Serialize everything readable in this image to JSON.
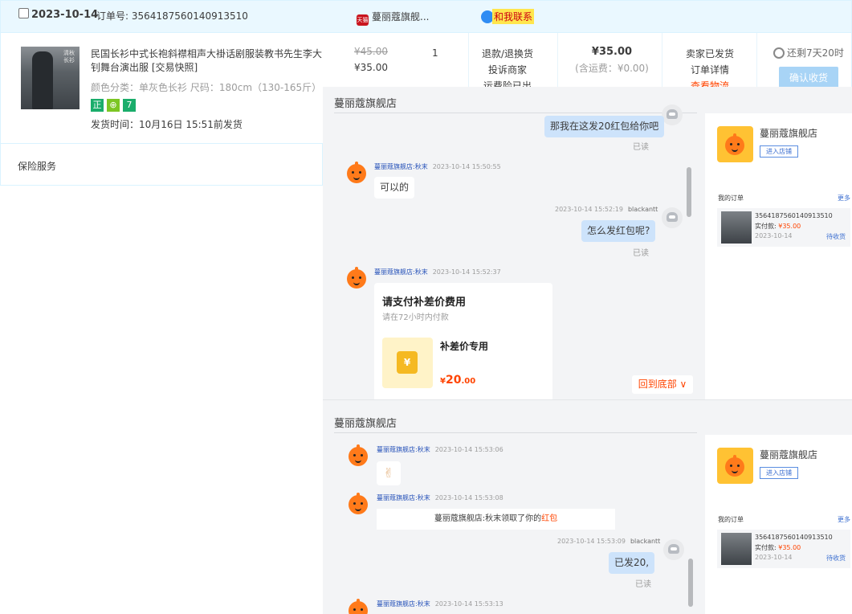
{
  "order": {
    "date": "2023-10-14",
    "order_no_label": "订单号: 3564187560140913510",
    "shop_name": "蔓丽蔻旗舰...",
    "shop_icon_text": "天猫",
    "contact_label": "和我联系",
    "product_title": "民国长衫中式长袍斜襟相声大褂话剧服装教书先生李大钊舞台演出服 [交易快照]",
    "thumb_text": "清秋长衫",
    "attrs": "颜色分类：单灰色长衫   尺码：180cm（130-165斤）",
    "badges": [
      {
        "text": "正",
        "color": "#1aad6b"
      },
      {
        "text": "⊕",
        "color": "#1aad6b"
      },
      {
        "text": "7",
        "color": "#1aad6b"
      }
    ],
    "ship_time": "发货时间：10月16日 15:51前发货",
    "price_old": "¥45.00",
    "price_new": "¥35.00",
    "quantity": "1",
    "after_sale": [
      "退款/退换货",
      "投诉商家",
      "运费险已出单"
    ],
    "total": "¥35.00",
    "shipping": "(含运费：¥0.00)",
    "status_lines": [
      "卖家已发货",
      "订单详情",
      "查看物流"
    ],
    "remaining": "还剩7天20时",
    "confirm_button": "确认收货",
    "insurance": "保险服务"
  },
  "chat1": {
    "shop_title": "蔓丽蔻旗舰店",
    "messages": {
      "m0_text": "那我在这发20红包给你吧",
      "m0_read": "已读",
      "m1_name": "蔓丽蔻旗舰店:秋末",
      "m1_time": "2023-10-14 15:50:55",
      "m1_text": "可以的",
      "m2_time": "2023-10-14 15:52:19",
      "m2_name": "blackantt",
      "m2_text": "怎么发红包呢?",
      "m2_read": "已读",
      "m3_name": "蔓丽蔻旗舰店:秋末",
      "m3_time": "2023-10-14 15:52:37"
    },
    "pay_card": {
      "title": "请支付补差价费用",
      "subtitle": "请在72小时内付款",
      "item_name": "补差价专用",
      "currency": "¥",
      "price_int": "20",
      "price_dec": ".00",
      "coin_text": "¥"
    },
    "back_bottom": "回到底部 ∨"
  },
  "chat2": {
    "shop_title": "蔓丽蔻旗舰店",
    "messages": {
      "m1_name": "蔓丽蔻旗舰店:秋末",
      "m1_time": "2023-10-14 15:53:06",
      "m1_emoji": "✌",
      "m2_name": "蔓丽蔻旗舰店:秋末",
      "m2_time": "2023-10-14 15:53:08",
      "notice_prefix": "蔓丽蔻旗舰店:秋末领取了你的",
      "notice_red": "红包",
      "m3_time": "2023-10-14 15:53:09",
      "m3_name": "blackantt",
      "m3_text": "已发20,",
      "m3_read": "已读",
      "m4_name": "蔓丽蔻旗舰店:秋末",
      "m4_time": "2023-10-14 15:53:13"
    }
  },
  "side": {
    "shop_name": "蔓丽蔻旗舰店",
    "enter_label": "进入店铺",
    "my_orders": "我的订单",
    "more": "更多",
    "card_no": "3564187560140913510",
    "card_pay_label": "实付款: ",
    "card_pay": "¥35.00",
    "card_date": "2023-10-14",
    "card_status": "待收货"
  }
}
